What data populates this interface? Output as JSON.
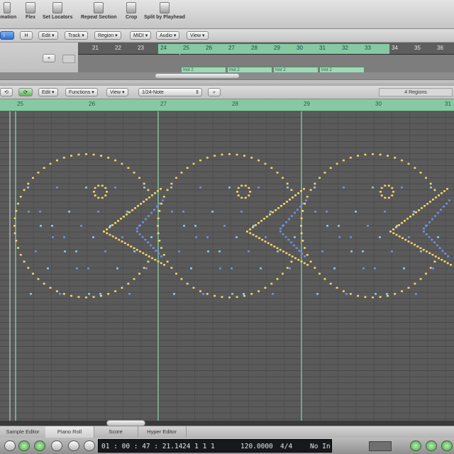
{
  "toolbar": {
    "items": [
      {
        "label": "omation",
        "icon": "automation-icon"
      },
      {
        "label": "Flex",
        "icon": "flex-icon"
      },
      {
        "label": "Set Locators",
        "icon": "locators-icon"
      },
      {
        "label": "Repeat Section",
        "icon": "repeat-icon"
      },
      {
        "label": "Crop",
        "icon": "crop-icon"
      },
      {
        "label": "Split by Playhead",
        "icon": "split-icon"
      }
    ]
  },
  "main_menu": {
    "h_button": "H",
    "items": [
      "Edit",
      "Track",
      "Region",
      "MIDI",
      "Audio",
      "View"
    ]
  },
  "arrange": {
    "bars": [
      "21",
      "22",
      "23",
      "24",
      "25",
      "26",
      "27",
      "28",
      "29",
      "30",
      "31",
      "32",
      "33",
      "34",
      "35",
      "36"
    ],
    "regions": [
      "Inst 2",
      "Inst 2",
      "Inst 2",
      "Inst 2"
    ]
  },
  "piano_roll": {
    "menus": [
      "Edit",
      "Functions",
      "View"
    ],
    "quantize": "1/24-Note",
    "region_count": "4 Regions",
    "bars": [
      "25",
      "26",
      "27",
      "28",
      "29",
      "30",
      "31"
    ],
    "note_colors": {
      "yellow": "#f2d266",
      "blue": "#6e8fe8",
      "cyan": "#8cc6f0"
    }
  },
  "tabs": [
    "Sample Editor",
    "Piano Roll",
    "Score",
    "Hyper Editor"
  ],
  "active_tab": "Piano Roll",
  "transport": {
    "time": "01 : 00 : 47 : 21.14",
    "position": "24   1   1     1",
    "tempo": "120.0000",
    "signature": "4/4",
    "in_mode": "No In"
  }
}
